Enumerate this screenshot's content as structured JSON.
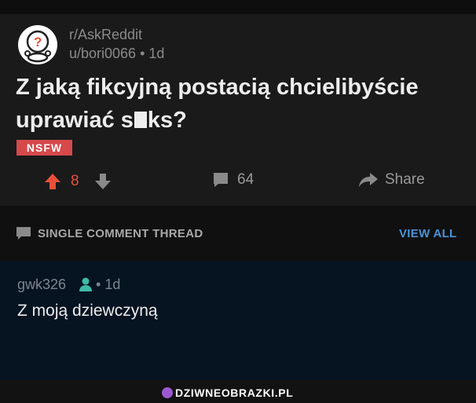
{
  "post": {
    "subreddit": "r/AskReddit",
    "author": "u/bori0066",
    "age": "1d",
    "separator": "•",
    "title_part1": "Z jaką fikcyjną postacią chcielibyście uprawiać s",
    "title_part2": "ks?",
    "nsfw_label": "NSFW",
    "score": "8",
    "comment_count": "64",
    "share_label": "Share"
  },
  "thread": {
    "label": "SINGLE COMMENT THREAD",
    "view_all": "VIEW ALL"
  },
  "comment": {
    "author": "gwk326",
    "separator": "•",
    "age": "1d",
    "body": "Z moją dziewczyną"
  },
  "watermark": {
    "text": "DZIWNEOBRAZKI.PL"
  },
  "colors": {
    "upvote": "#e8503a",
    "nsfw": "#d6494b",
    "link": "#4a93d6",
    "user_icon": "#3fb9a5",
    "comment_bg": "#061321"
  }
}
